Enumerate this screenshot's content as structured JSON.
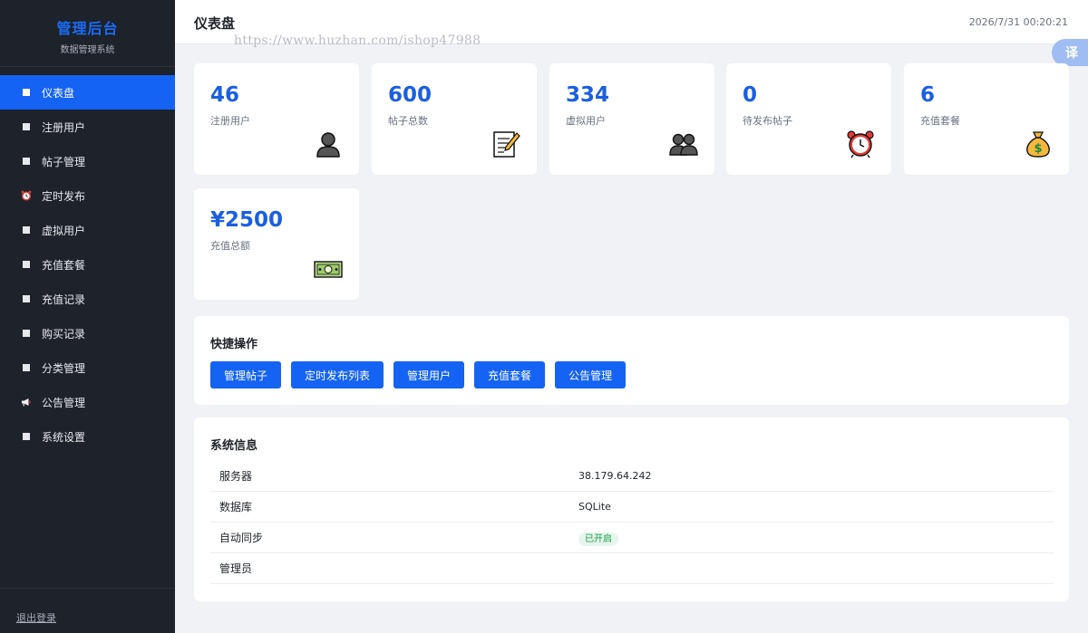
{
  "sidebar": {
    "brand_title": "管理后台",
    "brand_subtitle": "数据管理系统",
    "items": [
      {
        "label": "仪表盘",
        "icon": "square-icon",
        "active": true
      },
      {
        "label": "注册用户",
        "icon": "square-icon"
      },
      {
        "label": "帖子管理",
        "icon": "square-icon"
      },
      {
        "label": "定时发布",
        "icon": "alarm-clock-icon"
      },
      {
        "label": "虚拟用户",
        "icon": "square-icon"
      },
      {
        "label": "充值套餐",
        "icon": "square-icon"
      },
      {
        "label": "充值记录",
        "icon": "square-icon"
      },
      {
        "label": "购买记录",
        "icon": "square-icon"
      },
      {
        "label": "分类管理",
        "icon": "square-icon"
      },
      {
        "label": "公告管理",
        "icon": "megaphone-icon"
      },
      {
        "label": "系统设置",
        "icon": "square-icon"
      }
    ],
    "logout_label": "退出登录"
  },
  "header": {
    "title": "仪表盘",
    "timestamp": "2026/7/31 00:20:21"
  },
  "watermark": "https://www.huzhan.com/ishop47988",
  "translate_label": "译",
  "stats": [
    {
      "value": "46",
      "label": "注册用户",
      "icon": "user-icon"
    },
    {
      "value": "600",
      "label": "帖子总数",
      "icon": "memo-icon"
    },
    {
      "value": "334",
      "label": "虚拟用户",
      "icon": "users-icon"
    },
    {
      "value": "0",
      "label": "待发布帖子",
      "icon": "alarm-clock-icon"
    },
    {
      "value": "6",
      "label": "充值套餐",
      "icon": "money-bag-icon"
    },
    {
      "value": "¥2500",
      "label": "充值总额",
      "icon": "banknote-icon"
    }
  ],
  "quick_actions": {
    "title": "快捷操作",
    "buttons": [
      "管理帖子",
      "定时发布列表",
      "管理用户",
      "充值套餐",
      "公告管理"
    ]
  },
  "system_info": {
    "title": "系统信息",
    "rows": [
      {
        "key": "服务器",
        "value": "38.179.64.242"
      },
      {
        "key": "数据库",
        "value": "SQLite"
      },
      {
        "key": "自动同步",
        "value": "已开启"
      },
      {
        "key": "管理员",
        "value": ""
      }
    ]
  },
  "colors": {
    "accent": "#1463f3",
    "sidebar_bg": "#1e222b",
    "stat_value": "#1a5fe0",
    "success": "#1c9c4a"
  }
}
